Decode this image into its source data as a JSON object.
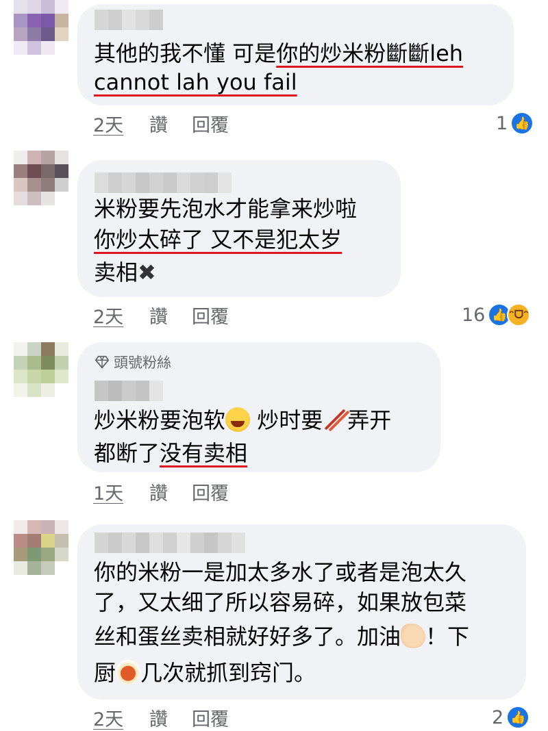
{
  "colors": {
    "underline": "#e0141e",
    "bubble": "#f0f2f5",
    "meta": "#65676b",
    "like_blue": "#1b74e4"
  },
  "comments": [
    {
      "avatar_colors": [
        "#e6e0ec",
        "#ddd6e6",
        "#c9bed8",
        "#eee9f2",
        "#a996c4",
        "#8a62b4",
        "#7b59a8",
        "#c9b4a0",
        "#b6a4c0",
        "#8e7aa6",
        "#6f5a8c",
        "#e3d3c1",
        "#efeaf3",
        "#cfc2dc",
        "#efe8f2",
        "#ffffff"
      ],
      "name_blur": [
        "#d6d6d6",
        "#cfcfcf",
        "#e2e2e2",
        "#d9d9d9",
        "#cdcdcd"
      ],
      "lines": [
        {
          "plain": "其他的我不懂 可是",
          "underlined": "你的炒米粉斷斷leh"
        },
        {
          "plain": "",
          "underlined": "cannot lah you fail"
        }
      ],
      "time": "2天",
      "like": "讚",
      "reply": "回覆",
      "reaction_count": "1",
      "reactions": [
        "like-icon"
      ]
    },
    {
      "avatar_colors": [
        "#f1eded",
        "#cdb3b3",
        "#b8a3a4",
        "#e7e2e2",
        "#9b7e80",
        "#6e4e52",
        "#7b6a6c",
        "#58505a",
        "#d9c8c2",
        "#a78e8f",
        "#8f7b7c",
        "#cfcfd1",
        "#e6dede",
        "#cdbfbf",
        "#e8e3e3",
        "#ffffff"
      ],
      "name_blur": [
        "#dcdcdc",
        "#cfcfcf",
        "#d6d6d6",
        "#c8c8c8",
        "#d2d2d2",
        "#cacaca",
        "#dadada",
        "#d0d0d0",
        "#cecece",
        "#e4e4e4"
      ],
      "lines": [
        {
          "plain": "米粉要先泡水才能拿来炒啦",
          "underlined": ""
        },
        {
          "plain": "",
          "underlined": "你炒太碎了 又不是犯太岁"
        },
        {
          "plain": "卖相",
          "underlined": ""
        }
      ],
      "cross": "✖",
      "time": "2天",
      "like": "讚",
      "reply": "回覆",
      "reaction_count": "16",
      "reactions": [
        "like-icon",
        "haha-icon"
      ]
    },
    {
      "avatar_colors": [
        "#f2f2ee",
        "#cbd4c4",
        "#8c7b5e",
        "#e6ebde",
        "#c6d2b6",
        "#aabb8e",
        "#7c8a5e",
        "#c2d0b0",
        "#dde6c6",
        "#c8d6a8",
        "#bfcf98",
        "#dfe8cc",
        "#f2f4ec",
        "#d8e2c4",
        "#ecefe4",
        "#ffffff"
      ],
      "name_blur": [
        "#c6c6c6",
        "#bcbcbc",
        "#cbcbcb",
        "#c4c4c4",
        "#e4e4e4"
      ],
      "badge": "頭號粉絲",
      "lines": [
        {
          "plain": "炒米粉要泡软",
          "underlined": "",
          "emoji": "laugh-cry-emoji",
          "after": " 炒时要",
          "emoji2": "chopsticks-emoji",
          "after2": "弄开"
        },
        {
          "plain": "都断了",
          "underlined": "没有卖相"
        }
      ],
      "time": "1天",
      "like": "讚",
      "reply": "回覆"
    },
    {
      "avatar_colors": [
        "#f1eaea",
        "#d7b7b3",
        "#c9b3b7",
        "#ede7e7",
        "#b98c86",
        "#a37c74",
        "#d9d48a",
        "#c4bfae",
        "#a69c7c",
        "#7e9a74",
        "#9aa884",
        "#d8d8c8",
        "#e8eae0",
        "#a7b29a",
        "#c5cbb8",
        "#ffffff"
      ],
      "name_blur": [
        "#d4d4d4",
        "#cbcbcb",
        "#d8d8d8",
        "#c8c8c8",
        "#dedede",
        "#d0d0d0",
        "#e6e6e6",
        "#cfcfcf",
        "#c6c6c6",
        "#d5d5d5",
        "#e0e0e0"
      ],
      "lines": [
        {
          "plain": "你的米粉一是加太多水了或者是泡太久"
        },
        {
          "plain": "了，又太细了所以容易碎，如果放包菜"
        },
        {
          "plain": "丝和蛋丝卖相就好好多了。加油",
          "emoji": "flexed-bicep-emoji",
          "after": "！下"
        },
        {
          "plain": "厨",
          "emoji": "spaghetti-emoji",
          "after": "几次就抓到窍门。"
        }
      ],
      "time": "2天",
      "like": "讚",
      "reply": "回覆",
      "reaction_count": "2",
      "reactions": [
        "like-icon"
      ]
    }
  ]
}
